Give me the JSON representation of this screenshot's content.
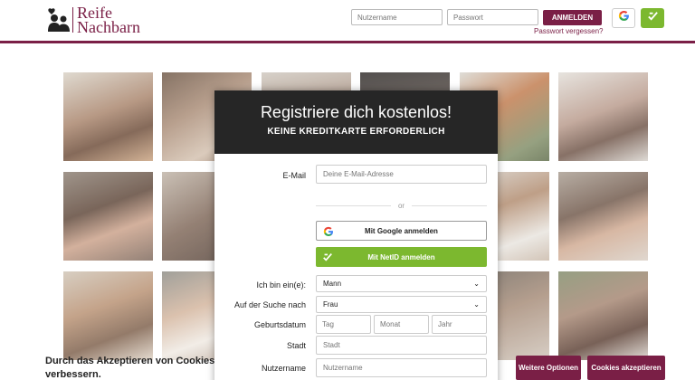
{
  "brand": {
    "line1": "Reife",
    "line2": "Nachbarn",
    "color": "#7a1f46"
  },
  "login": {
    "username_placeholder": "Nutzername",
    "password_placeholder": "Passwort",
    "submit_label": "ANMELDEN",
    "forgot_label": "Passwort vergessen?",
    "google_icon": "google-icon",
    "netid_icon": "netid-icon"
  },
  "modal": {
    "title": "Registriere dich kostenlos!",
    "subtitle": "KEINE KREDITKARTE ERFORDERLICH",
    "email_label": "E-Mail",
    "email_placeholder": "Deine E-Mail-Adresse",
    "or_text": "or",
    "google_button": "Mit Google anmelden",
    "netid_button": "Mit NetID anmelden",
    "gender_label": "Ich bin ein(e):",
    "gender_value": "Mann",
    "seeking_label": "Auf der Suche nach",
    "seeking_value": "Frau",
    "birthdate_label": "Geburtsdatum",
    "day_placeholder": "Tag",
    "month_placeholder": "Monat",
    "year_placeholder": "Jahr",
    "city_label": "Stadt",
    "city_placeholder": "Stadt",
    "username_label": "Nutzername",
    "username_placeholder": "Nutzername"
  },
  "cookie": {
    "text": "Durch das Akzeptieren von Cookies verbessern.",
    "options_button": "Weitere Optionen",
    "accept_button": "Cookies akzeptieren"
  },
  "colors": {
    "accent": "#7a1f46",
    "netid": "#7cb82f",
    "modal_header": "#262626"
  }
}
